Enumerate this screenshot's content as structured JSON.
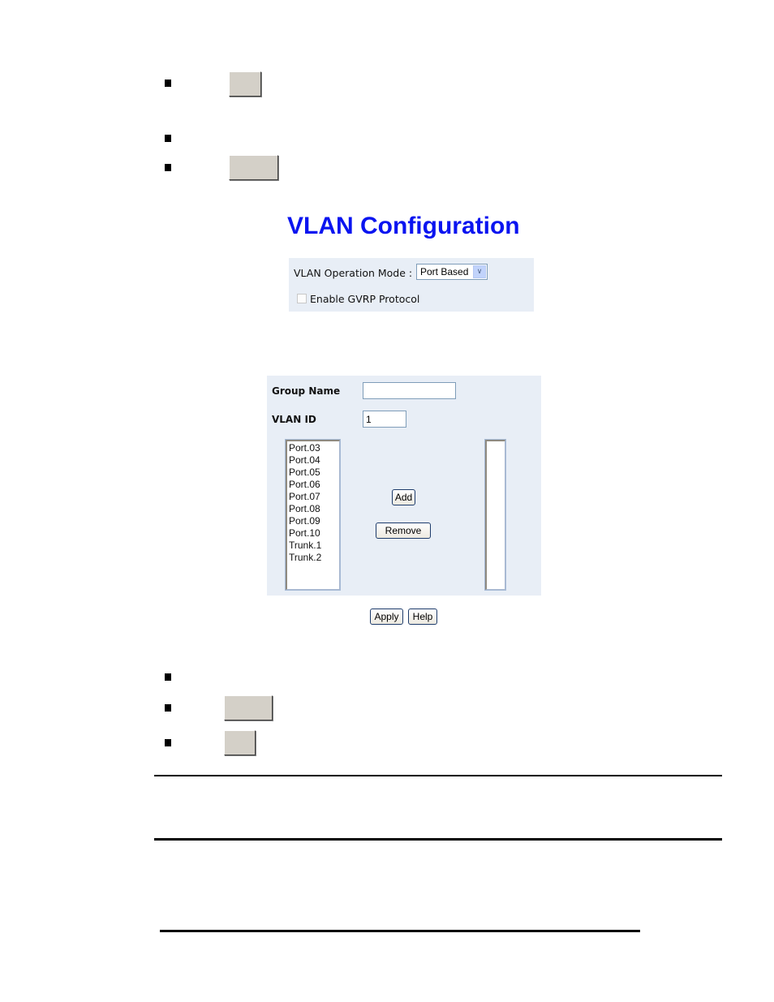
{
  "doc": {
    "bullets_top": [
      {
        "id": 1,
        "has_button": true
      },
      {
        "id": 2,
        "has_button": false
      },
      {
        "id": 3,
        "has_button": true
      }
    ],
    "bullets_bottom": [
      {
        "id": 1,
        "has_button": false
      },
      {
        "id": 2,
        "has_button": true
      },
      {
        "id": 3,
        "has_button": true
      }
    ]
  },
  "vlan_config": {
    "title": "VLAN Configuration",
    "operation_mode_label": "VLAN Operation Mode :",
    "operation_mode_value": "Port Based",
    "gvrp_label": "Enable GVRP Protocol",
    "gvrp_checked": false
  },
  "group_form": {
    "group_name_label": "Group Name",
    "group_name_value": "",
    "vlan_id_label": "VLAN ID",
    "vlan_id_value": "1",
    "available_ports": [
      "Port.03",
      "Port.04",
      "Port.05",
      "Port.06",
      "Port.07",
      "Port.08",
      "Port.09",
      "Port.10",
      "Trunk.1",
      "Trunk.2"
    ],
    "member_ports": [],
    "add_label": "Add",
    "remove_label": "Remove",
    "apply_label": "Apply",
    "help_label": "Help"
  }
}
